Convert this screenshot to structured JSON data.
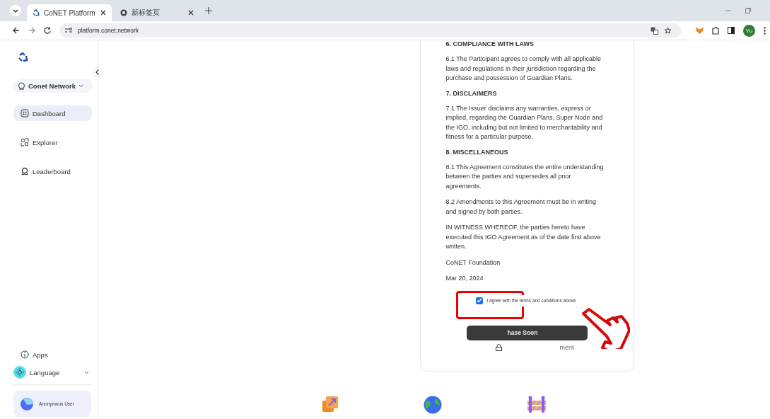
{
  "browser": {
    "tabs": [
      {
        "title": "CoNET Platform",
        "selected": true
      },
      {
        "title": "新标签页",
        "selected": false
      }
    ],
    "url": "platform.conet.network",
    "profile": "Yu"
  },
  "sidebar": {
    "network": "Conet Network",
    "items": [
      {
        "label": "Dashboard",
        "selected": true
      },
      {
        "label": "Explorer",
        "selected": false
      },
      {
        "label": "Leaderboard",
        "selected": false
      }
    ],
    "apps": "Apps",
    "language": "Language",
    "user": "Anonymous User"
  },
  "agreement": {
    "sections": [
      {
        "kind": "heading",
        "text": "6. COMPLIANCE WITH LAWS"
      },
      {
        "kind": "para",
        "text": "6.1 The Participant agrees to comply with all applicable laws and regulations in their jurisdiction regarding the purchase and possession of Guardian Plans."
      },
      {
        "kind": "heading",
        "text": "7. DISCLAIMERS"
      },
      {
        "kind": "para",
        "text": "7.1 The Issuer disclaims any warranties, express or implied, regarding the Guardian Plans, Super Node and the IGO, including but not limited to merchantability and fitness for a particular purpose."
      },
      {
        "kind": "heading",
        "text": "8. MISCELLANEOUS"
      },
      {
        "kind": "para",
        "text": "8.1 This Agreement constitutes the entire understanding between the parties and supersedes all prior agreements."
      },
      {
        "kind": "para",
        "text": "8.2 Amendments to this Agreement must be in writing and signed by both parties."
      },
      {
        "kind": "para",
        "text": "IN WITNESS WHEREOF, the parties hereto have executed this IGO Agreement as of the date first above written."
      },
      {
        "kind": "para",
        "text": "CoNET Foundation"
      },
      {
        "kind": "para",
        "text": "Mar 20, 2024"
      }
    ],
    "agree": {
      "label": "I agree with the terms and conditions above",
      "checked": true
    },
    "button": "hase Soon",
    "secure": "ment"
  }
}
